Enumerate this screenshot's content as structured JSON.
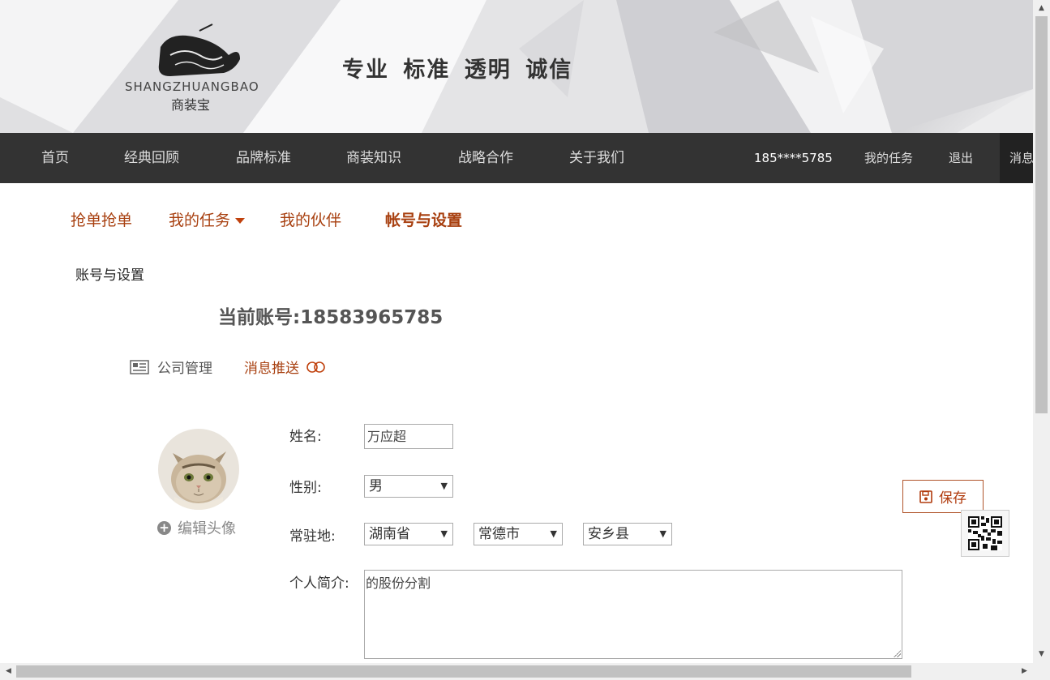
{
  "header": {
    "logo_en": "SHANGZHUANGBAO",
    "logo_cn": "商装宝",
    "slogan": "专业 标准 透明 诚信"
  },
  "nav": {
    "items": [
      "首页",
      "经典回顾",
      "品牌标准",
      "商装知识",
      "战略合作",
      "关于我们"
    ],
    "phone": "185****5785",
    "my_tasks": "我的任务",
    "logout": "退出",
    "messages": "消息"
  },
  "subnav": {
    "items": [
      "抢单抢单",
      "我的任务",
      "我的伙伴",
      "帐号与设置"
    ],
    "active": "帐号与设置"
  },
  "breadcrumb": "账号与设置",
  "account": {
    "label": "当前账号:18583965785"
  },
  "settings_tabs": {
    "company": "公司管理",
    "push": "消息推送"
  },
  "avatar": {
    "edit_label": "编辑头像"
  },
  "form": {
    "name_label": "姓名:",
    "name_value": "万应超",
    "gender_label": "性别:",
    "gender_value": "男",
    "location_label": "常驻地:",
    "province": "湖南省",
    "city": "常德市",
    "county": "安乡县",
    "bio_label": "个人简介:",
    "bio_value": "的股份分割"
  },
  "save_label": "保存",
  "colors": {
    "accent": "#a84010",
    "nav_bg": "#333333"
  }
}
